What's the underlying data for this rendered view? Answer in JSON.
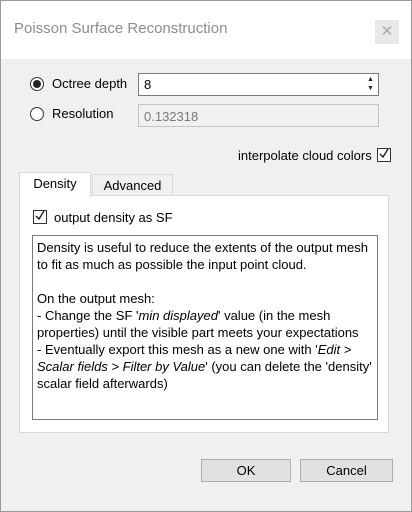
{
  "window": {
    "title": "Poisson Surface Reconstruction",
    "close_symbol": "✕"
  },
  "octree": {
    "label": "Octree depth",
    "value": "8",
    "selected": true
  },
  "resolution": {
    "label": "Resolution",
    "value": "0.132318",
    "selected": false
  },
  "interpolate": {
    "label": "interpolate cloud colors",
    "checked": true
  },
  "tabs": [
    {
      "label": "Density",
      "active": true
    },
    {
      "label": "Advanced",
      "active": false
    }
  ],
  "density": {
    "output_label": "output density as SF",
    "output_checked": true,
    "help": {
      "line1": "Density is useful to reduce the extents of the output mesh to fit as much as possible the input point cloud.",
      "heading": "On the output mesh:",
      "change_prefix": "- Change the SF '",
      "change_italic": "min displayed",
      "change_suffix": "' value (in the mesh properties) until the visible part meets your expectations",
      "export_prefix": "- Eventually export this mesh as a new one with '",
      "export_italic": "Edit > Scalar fields > Filter by Value",
      "export_suffix": "' (you can delete the 'density' scalar field afterwards)"
    }
  },
  "buttons": {
    "ok": "OK",
    "cancel": "Cancel"
  },
  "icons": {
    "spin_up": "▲",
    "spin_down": "▼",
    "checkmark": "checkmark-icon"
  }
}
